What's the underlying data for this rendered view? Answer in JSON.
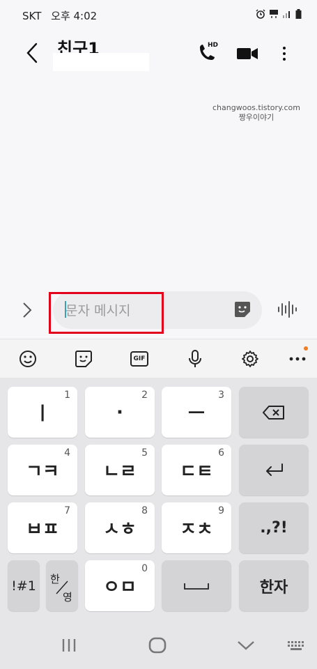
{
  "status_bar": {
    "carrier": "SKT",
    "time": "오후 4:02"
  },
  "header": {
    "contact_name": "친구1",
    "call_badge": "HD"
  },
  "watermark": {
    "line1": "changwoos.tistory.com",
    "line2": "짱우이야기"
  },
  "composer": {
    "placeholder": "문자 메시지"
  },
  "toolbar": {
    "gif_label": "GIF"
  },
  "keyboard": {
    "rows": [
      [
        {
          "label": "ㅣ",
          "num": "1"
        },
        {
          "label": "·",
          "num": "2"
        },
        {
          "label": "ㅡ",
          "num": "3"
        }
      ],
      [
        {
          "label": "ㄱㅋ",
          "num": "4"
        },
        {
          "label": "ㄴㄹ",
          "num": "5"
        },
        {
          "label": "ㄷㅌ",
          "num": "6"
        }
      ],
      [
        {
          "label": "ㅂㅍ",
          "num": "7"
        },
        {
          "label": "ㅅㅎ",
          "num": "8"
        },
        {
          "label": "ㅈㅊ",
          "num": "9"
        }
      ]
    ],
    "punct_label": ".,?!",
    "symbols_label": "!#1",
    "lang_top": "한",
    "lang_bottom": "영",
    "zero_key": {
      "label": "ㅇㅁ",
      "num": "0"
    },
    "hanja_label": "한자"
  },
  "colors": {
    "highlight": "#e2001a",
    "accent_dot": "#f07d22"
  }
}
